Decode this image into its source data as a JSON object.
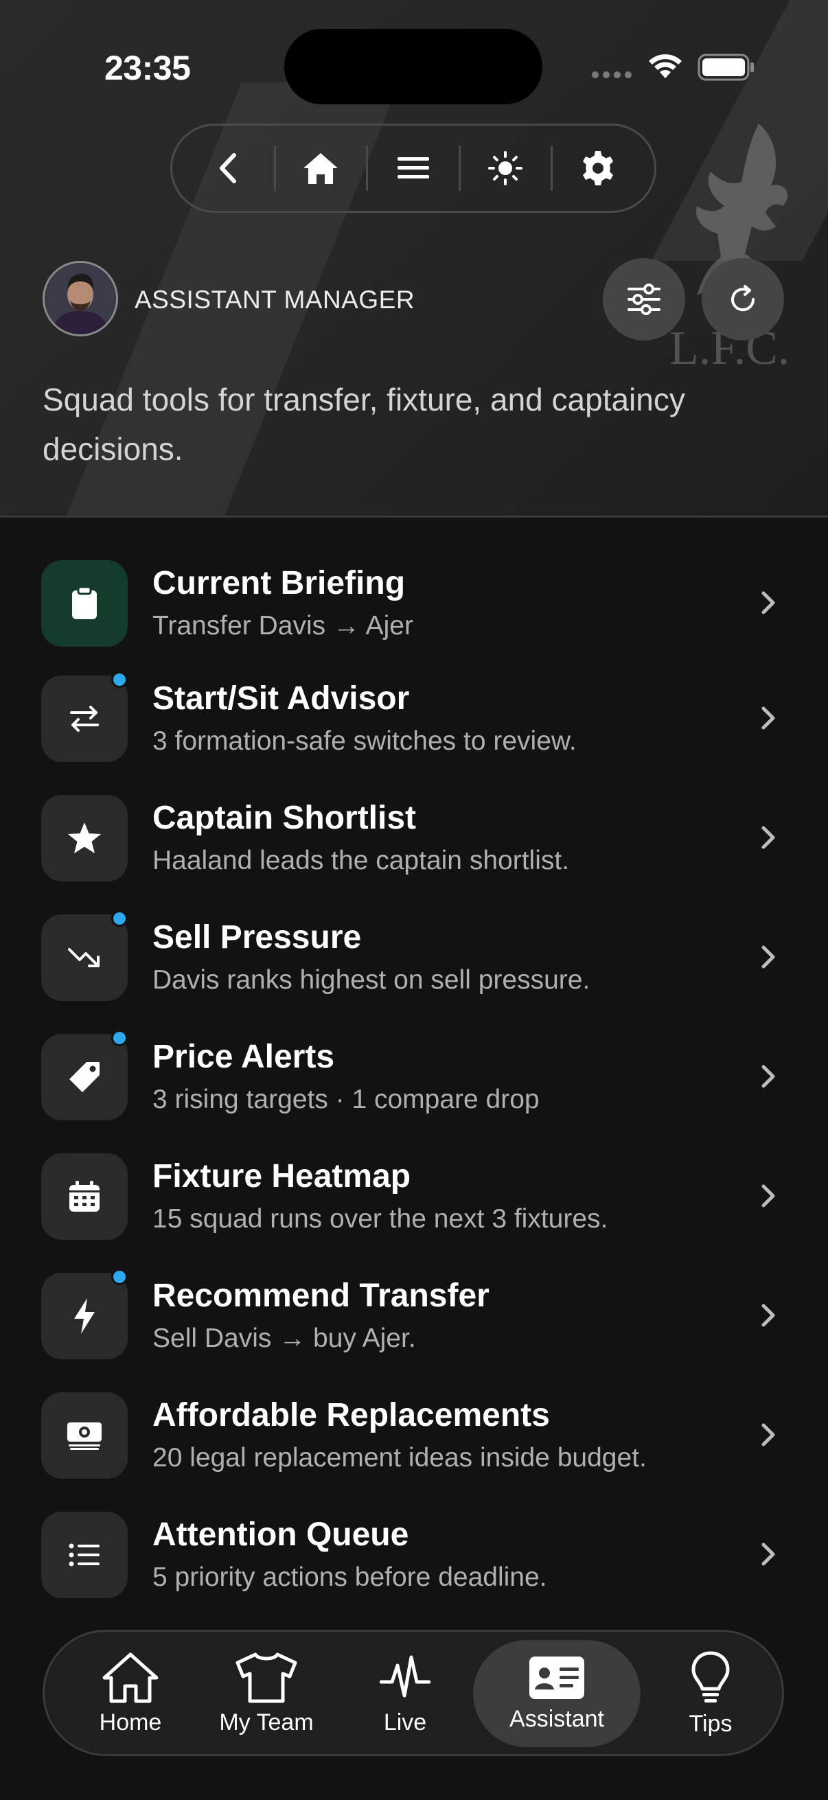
{
  "status_bar": {
    "time": "23:35"
  },
  "header": {
    "role_label": "ASSISTANT MANAGER",
    "subtitle": "Squad tools for transfer, fixture, and captaincy decisions."
  },
  "nav_pill": {
    "buttons": [
      "back-icon",
      "home-icon",
      "menu-icon",
      "brightness-icon",
      "settings-icon"
    ]
  },
  "colors": {
    "background": "#121212",
    "tile": "#2a2a2a",
    "tile_highlight": "#143a2a",
    "notification_dot": "#2ea8ef",
    "secondary_text": "#b0b0b0"
  },
  "items": [
    {
      "icon": "clipboard-icon",
      "title": "Current Briefing",
      "desc": "Transfer Davis → Ajer",
      "badge": false,
      "highlight": true
    },
    {
      "icon": "swap-icon",
      "title": "Start/Sit Advisor",
      "desc": "3 formation-safe switches to review.",
      "badge": true
    },
    {
      "icon": "star-icon",
      "title": "Captain Shortlist",
      "desc": "Haaland leads the captain shortlist.",
      "badge": false
    },
    {
      "icon": "trend-down-icon",
      "title": "Sell Pressure",
      "desc": "Davis ranks highest on sell pressure.",
      "badge": true
    },
    {
      "icon": "price-tag-icon",
      "title": "Price Alerts",
      "desc": "3 rising targets · 1 compare drop",
      "badge": true
    },
    {
      "icon": "calendar-icon",
      "title": "Fixture Heatmap",
      "desc": "15 squad runs over the next 3 fixtures.",
      "badge": false
    },
    {
      "icon": "lightning-icon",
      "title": "Recommend Transfer",
      "desc": "Sell Davis → buy Ajer.",
      "badge": true
    },
    {
      "icon": "money-icon",
      "title": "Affordable Replacements",
      "desc": "20 legal replacement ideas inside budget.",
      "badge": false
    },
    {
      "icon": "list-icon",
      "title": "Attention Queue",
      "desc": "5 priority actions before deadline.",
      "badge": false
    }
  ],
  "tabbar": {
    "tabs": [
      {
        "label": "Home",
        "icon": "home-icon"
      },
      {
        "label": "My Team",
        "icon": "shirt-icon"
      },
      {
        "label": "Live",
        "icon": "pulse-icon"
      },
      {
        "label": "Assistant",
        "icon": "id-card-icon",
        "active": true
      },
      {
        "label": "Tips",
        "icon": "lightbulb-icon"
      }
    ]
  }
}
